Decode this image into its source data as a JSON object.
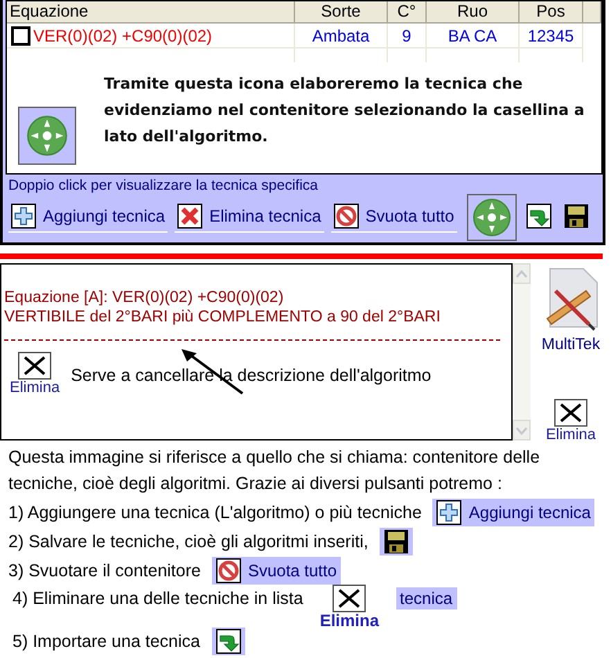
{
  "table": {
    "columns": [
      "Equazione",
      "Sorte",
      "C°",
      "Ruo",
      "Pos"
    ],
    "rows": [
      {
        "checked": false,
        "cells": [
          "VER(0)(02) +C90(0)(02)",
          "Ambata",
          "9",
          "BA CA",
          "12345"
        ]
      }
    ]
  },
  "callout": {
    "text": "Tramite questa icona elaboreremo la tecnica che evidenziamo nel contenitore selezionando la casellina a lato dell'algoritmo."
  },
  "hint": "Doppio click per visualizzare la tecnica specifica",
  "toolbar": [
    {
      "kind": "add",
      "label": "Aggiungi tecnica"
    },
    {
      "kind": "delete",
      "label": "Elimina tecnica"
    },
    {
      "kind": "clear",
      "label": "Svuota tutto"
    },
    {
      "kind": "process"
    },
    {
      "kind": "import"
    },
    {
      "kind": "save"
    }
  ],
  "description": {
    "lines": [
      "Equazione [A]: VER(0)(02) +C90(0)(02)",
      "VERTIBILE del 2°BARI più  COMPLEMENTO a 90 del 2°BARI"
    ],
    "delete_label": "Elimina",
    "note": "Serve a cancellare la descrizione dell'algoritmo"
  },
  "side": {
    "app_label": "MultiTek",
    "delete_label": "Elimina"
  },
  "instructions": {
    "intro": "Questa immagine si riferisce a quello che si chiama: contenitore delle tecniche, cioè degli algoritmi. Grazie ai diversi pulsanti potremo :",
    "steps": [
      {
        "text": "1) Aggiungere una tecnica (L'algoritmo) o più tecniche",
        "kind": "add",
        "label": "Aggiungi tecnica"
      },
      {
        "text": "2) Salvare le tecniche, cioè gli algoritmi inseriti,",
        "kind": "save"
      },
      {
        "text": "3) Svuotare il contenitore",
        "kind": "clear",
        "label": "Svuota tutto"
      },
      {
        "text": "4) Eliminare una delle tecniche in lista",
        "kind": "delete",
        "label": "tecnica",
        "sublabel": "Elimina"
      },
      {
        "text": "5) Importare una tecnica",
        "kind": "import"
      }
    ]
  }
}
